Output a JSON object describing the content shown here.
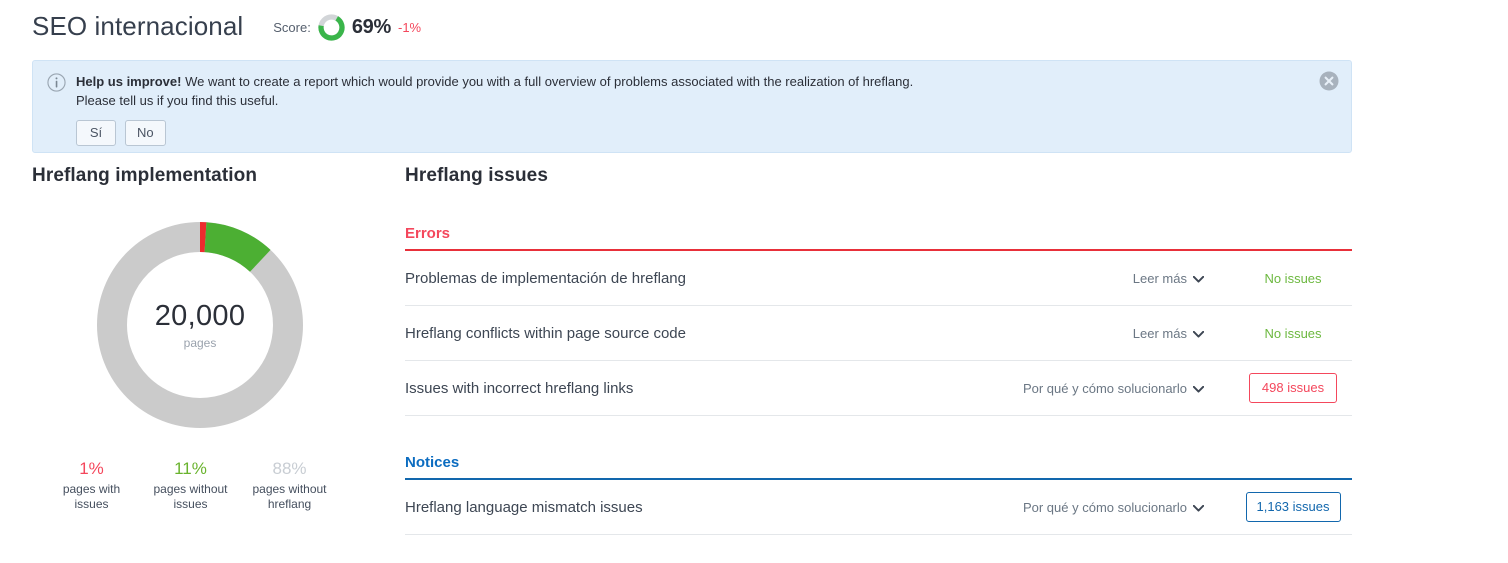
{
  "header": {
    "title": "SEO internacional",
    "score_label": "Score:",
    "score_value": "69%",
    "score_delta": "-1%",
    "score_percent": 69,
    "score_ring_color": "#3ab54a",
    "score_track_color": "#d2d5d8"
  },
  "banner": {
    "icon": "info-icon",
    "strong": "Help us improve!",
    "line1": " We want to create a report which would provide you with a full overview of problems associated with the realization of hreflang.",
    "line2": "Please tell us if you find this useful.",
    "yes_label": "Sí",
    "no_label": "No",
    "close_icon": "close-icon"
  },
  "implementation": {
    "title": "Hreflang implementation",
    "center_number": "20,000",
    "center_sub": "pages",
    "legend": [
      {
        "pct": "1%",
        "line1": "pages with",
        "line2": "issues",
        "color": "#f4475c",
        "tone": "red"
      },
      {
        "pct": "11%",
        "line1": "pages without",
        "line2": "issues",
        "color": "#69b32d",
        "tone": "green"
      },
      {
        "pct": "88%",
        "line1": "pages without",
        "line2": "hreflang",
        "color": "#c8cdd3",
        "tone": "gray"
      }
    ]
  },
  "chart_data": {
    "type": "pie",
    "title": "Hreflang implementation",
    "categories": [
      "pages with issues",
      "pages without issues",
      "pages without hreflang"
    ],
    "values": [
      1,
      11,
      88
    ],
    "unit": "%",
    "total_label": "20,000",
    "total_sub": "pages",
    "colors": [
      "#ee2b2e",
      "#4caf33",
      "#cbcbcb"
    ],
    "legend": "bottom",
    "donut": true
  },
  "issues": {
    "title": "Hreflang issues",
    "groups": [
      {
        "label": "Errors",
        "tone": "errors",
        "rows": [
          {
            "name": "Problemas de implementación de hreflang",
            "action": "Leer más",
            "status_type": "none",
            "status": "No issues"
          },
          {
            "name": "Hreflang conflicts within page source code",
            "action": "Leer más",
            "status_type": "none",
            "status": "No issues"
          },
          {
            "name": "Issues with incorrect hreflang links",
            "action": "Por qué y cómo solucionarlo",
            "status_type": "badge-error",
            "status": "498 issues"
          }
        ]
      },
      {
        "label": "Notices",
        "tone": "notices",
        "rows": [
          {
            "name": "Hreflang language mismatch issues",
            "action": "Por qué y cómo solucionarlo",
            "status_type": "badge-notice",
            "status": "1,163 issues"
          }
        ]
      }
    ]
  }
}
